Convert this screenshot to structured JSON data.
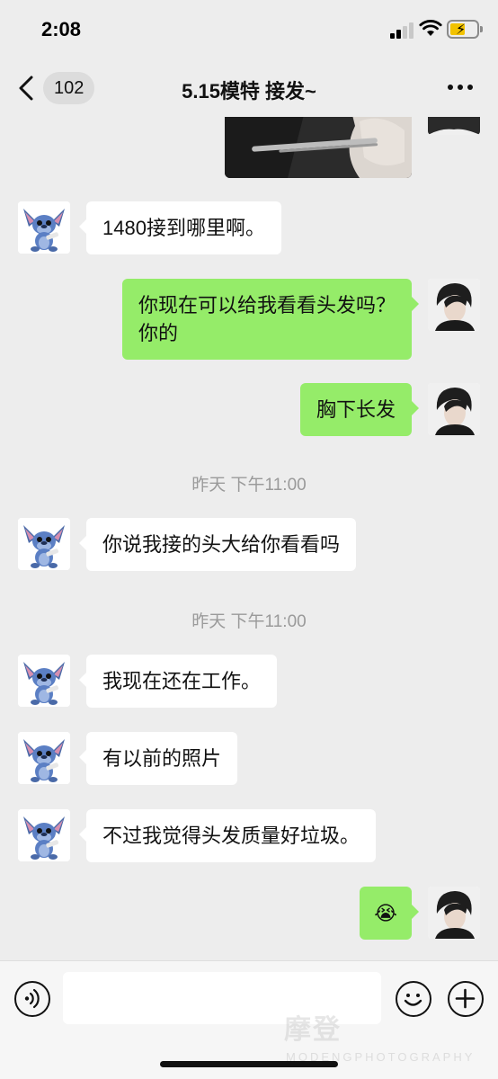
{
  "status_bar": {
    "time": "2:08"
  },
  "header": {
    "unread_count": "102",
    "title": "5.15模特 接发~"
  },
  "timestamps": [
    "昨天 下午11:00",
    "昨天 下午11:00"
  ],
  "messages": [
    {
      "side": "left",
      "text": "1480接到哪里啊。"
    },
    {
      "side": "right",
      "line1": "你现在可以给我看看头发吗？",
      "line2": "你的"
    },
    {
      "side": "right",
      "text": "胸下长发"
    },
    {
      "side": "left",
      "text": "你说我接的头大给你看看吗"
    },
    {
      "side": "left",
      "text": "我现在还在工作。"
    },
    {
      "side": "left",
      "text": "有以前的照片"
    },
    {
      "side": "left",
      "text": "不过我觉得头发质量好垃圾。"
    },
    {
      "side": "right",
      "emoji": "😭"
    }
  ],
  "input": {
    "placeholder": ""
  },
  "watermark": {
    "main": "摩登",
    "sub": "MODENGPHOTOGRAPHY"
  },
  "colors": {
    "outgoing_bubble": "#95ec69",
    "incoming_bubble": "#ffffff",
    "background": "#ededed"
  }
}
